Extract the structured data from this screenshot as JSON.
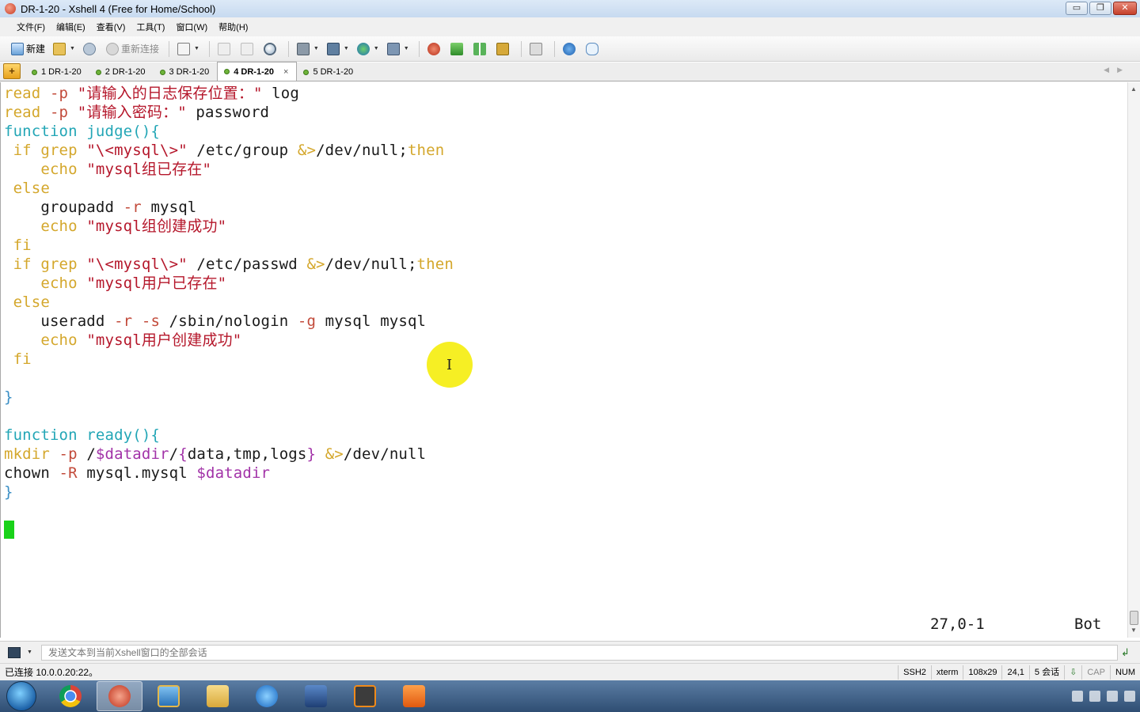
{
  "window": {
    "title": "DR-1-20 - Xshell 4 (Free for Home/School)",
    "buttons": {
      "minimize": "▭",
      "restore": "❐",
      "close": "✕"
    }
  },
  "menu": [
    "文件(F)",
    "编辑(E)",
    "查看(V)",
    "工具(T)",
    "窗口(W)",
    "帮助(H)"
  ],
  "toolbar": {
    "new_label": "新建",
    "reconnect_label": "重新连接"
  },
  "tabs": [
    {
      "label": "1 DR-1-20",
      "active": false
    },
    {
      "label": "2 DR-1-20",
      "active": false
    },
    {
      "label": "3 DR-1-20",
      "active": false
    },
    {
      "label": "4 DR-1-20",
      "active": true
    },
    {
      "label": "5 DR-1-20",
      "active": false
    }
  ],
  "terminal": {
    "lines": [
      [
        [
          "c-kw",
          "read"
        ],
        [
          "c-norm",
          " "
        ],
        [
          "c-opt",
          "-p"
        ],
        [
          "c-norm",
          " "
        ],
        [
          "c-str",
          "\"请输入的日志保存位置：\""
        ],
        [
          "c-norm",
          " log"
        ]
      ],
      [
        [
          "c-kw",
          "read"
        ],
        [
          "c-norm",
          " "
        ],
        [
          "c-opt",
          "-p"
        ],
        [
          "c-norm",
          " "
        ],
        [
          "c-str",
          "\"请输入密码：\""
        ],
        [
          "c-norm",
          " password"
        ]
      ],
      [
        [
          "c-fn",
          "function judge(){"
        ]
      ],
      [
        [
          "c-kw",
          " if grep "
        ],
        [
          "c-str",
          "\"\\<mysql\\>\""
        ],
        [
          "c-norm",
          " /etc/group "
        ],
        [
          "c-op",
          "&>"
        ],
        [
          "c-norm",
          "/dev/null;"
        ],
        [
          "c-kw",
          "then"
        ]
      ],
      [
        [
          "c-kw",
          "    echo "
        ],
        [
          "c-str",
          "\"mysql组已存在\""
        ]
      ],
      [
        [
          "c-kw",
          " else"
        ]
      ],
      [
        [
          "c-norm",
          "    groupadd "
        ],
        [
          "c-opt",
          "-r"
        ],
        [
          "c-norm",
          " mysql"
        ]
      ],
      [
        [
          "c-kw",
          "    echo "
        ],
        [
          "c-str",
          "\"mysql组创建成功\""
        ]
      ],
      [
        [
          "c-kw",
          " fi"
        ]
      ],
      [
        [
          "c-kw",
          " if grep "
        ],
        [
          "c-str",
          "\"\\<mysql\\>\""
        ],
        [
          "c-norm",
          " /etc/passwd "
        ],
        [
          "c-op",
          "&>"
        ],
        [
          "c-norm",
          "/dev/null;"
        ],
        [
          "c-kw",
          "then"
        ]
      ],
      [
        [
          "c-kw",
          "    echo "
        ],
        [
          "c-str",
          "\"mysql用户已存在\""
        ]
      ],
      [
        [
          "c-kw",
          " else"
        ]
      ],
      [
        [
          "c-norm",
          "    useradd "
        ],
        [
          "c-opt",
          "-r"
        ],
        [
          "c-norm",
          " "
        ],
        [
          "c-opt",
          "-s"
        ],
        [
          "c-norm",
          " /sbin/nologin "
        ],
        [
          "c-opt",
          "-g"
        ],
        [
          "c-norm",
          " mysql mysql"
        ]
      ],
      [
        [
          "c-kw",
          "    echo "
        ],
        [
          "c-str",
          "\"mysql用户创建成功\""
        ]
      ],
      [
        [
          "c-kw",
          " fi"
        ]
      ],
      [
        [
          "c-norm",
          ""
        ]
      ],
      [
        [
          "c-br",
          "}"
        ]
      ],
      [
        [
          "c-norm",
          ""
        ]
      ],
      [
        [
          "c-fn",
          "function ready(){"
        ]
      ],
      [
        [
          "c-kw",
          "mkdir"
        ],
        [
          "c-norm",
          " "
        ],
        [
          "c-opt",
          "-p"
        ],
        [
          "c-norm",
          " /"
        ],
        [
          "c-var",
          "$datadir"
        ],
        [
          "c-norm",
          "/"
        ],
        [
          "c-var",
          "{"
        ],
        [
          "c-norm",
          "data,tmp,logs"
        ],
        [
          "c-var",
          "}"
        ],
        [
          "c-norm",
          " "
        ],
        [
          "c-op",
          "&>"
        ],
        [
          "c-norm",
          "/dev/null"
        ]
      ],
      [
        [
          "c-norm",
          "chown "
        ],
        [
          "c-opt",
          "-R"
        ],
        [
          "c-norm",
          " mysql.mysql "
        ],
        [
          "c-var",
          "$datadir"
        ]
      ],
      [
        [
          "c-br",
          "}"
        ]
      ]
    ],
    "status_position": "27,0-1",
    "status_scroll": "Bot"
  },
  "compose": {
    "placeholder": "发送文本到当前Xshell窗口的全部会话"
  },
  "statusbar": {
    "connection": "已连接 10.0.0.20:22。",
    "protocol": "SSH2",
    "term": "xterm",
    "size": "108x29",
    "cursor": "24,1",
    "sessions": "5 会话",
    "cap": "CAP",
    "num": "NUM"
  },
  "colors": {
    "keyword": "#d4a72c",
    "function": "#23a6b6",
    "string": "#b5172b",
    "variable": "#a233a8",
    "cursor": "#19d219",
    "mouse_highlight": "#f6ee18"
  }
}
